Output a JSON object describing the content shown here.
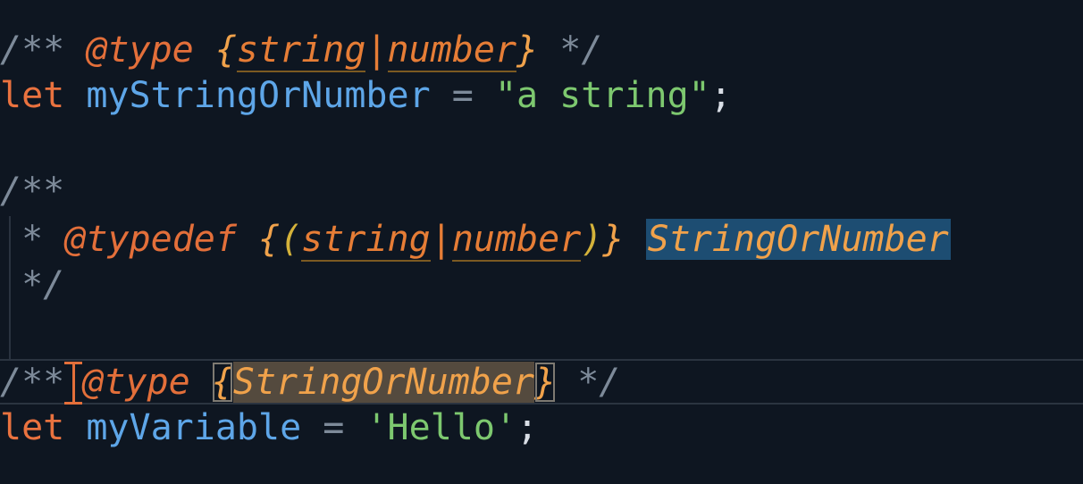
{
  "code": {
    "l1": {
      "open": "/**",
      "tag": "@type",
      "lb": "{",
      "t1": "string",
      "pipe": "|",
      "t2": "number",
      "rb": "}",
      "close": "*/"
    },
    "l2": {
      "kw": "let",
      "name": "myStringOrNumber",
      "eq": "=",
      "val": "\"a string\"",
      "semi": ";"
    },
    "l3": {
      "open": "/**"
    },
    "l4": {
      "star": "*",
      "tag": "@typedef",
      "lb": "{",
      "lp": "(",
      "t1": "string",
      "pipe": "|",
      "t2": "number",
      "rp": ")",
      "rb": "}",
      "name": "StringOrNumber"
    },
    "l5": {
      "close": "*/"
    },
    "l6": {
      "open": "/**",
      "tag": "@type",
      "lb": "{",
      "type": "StringOrNumber",
      "rb": "}",
      "close": "*/"
    },
    "l7": {
      "kw": "let",
      "name": "myVariable",
      "eq": "=",
      "val": "'Hello'",
      "semi": ";"
    }
  }
}
